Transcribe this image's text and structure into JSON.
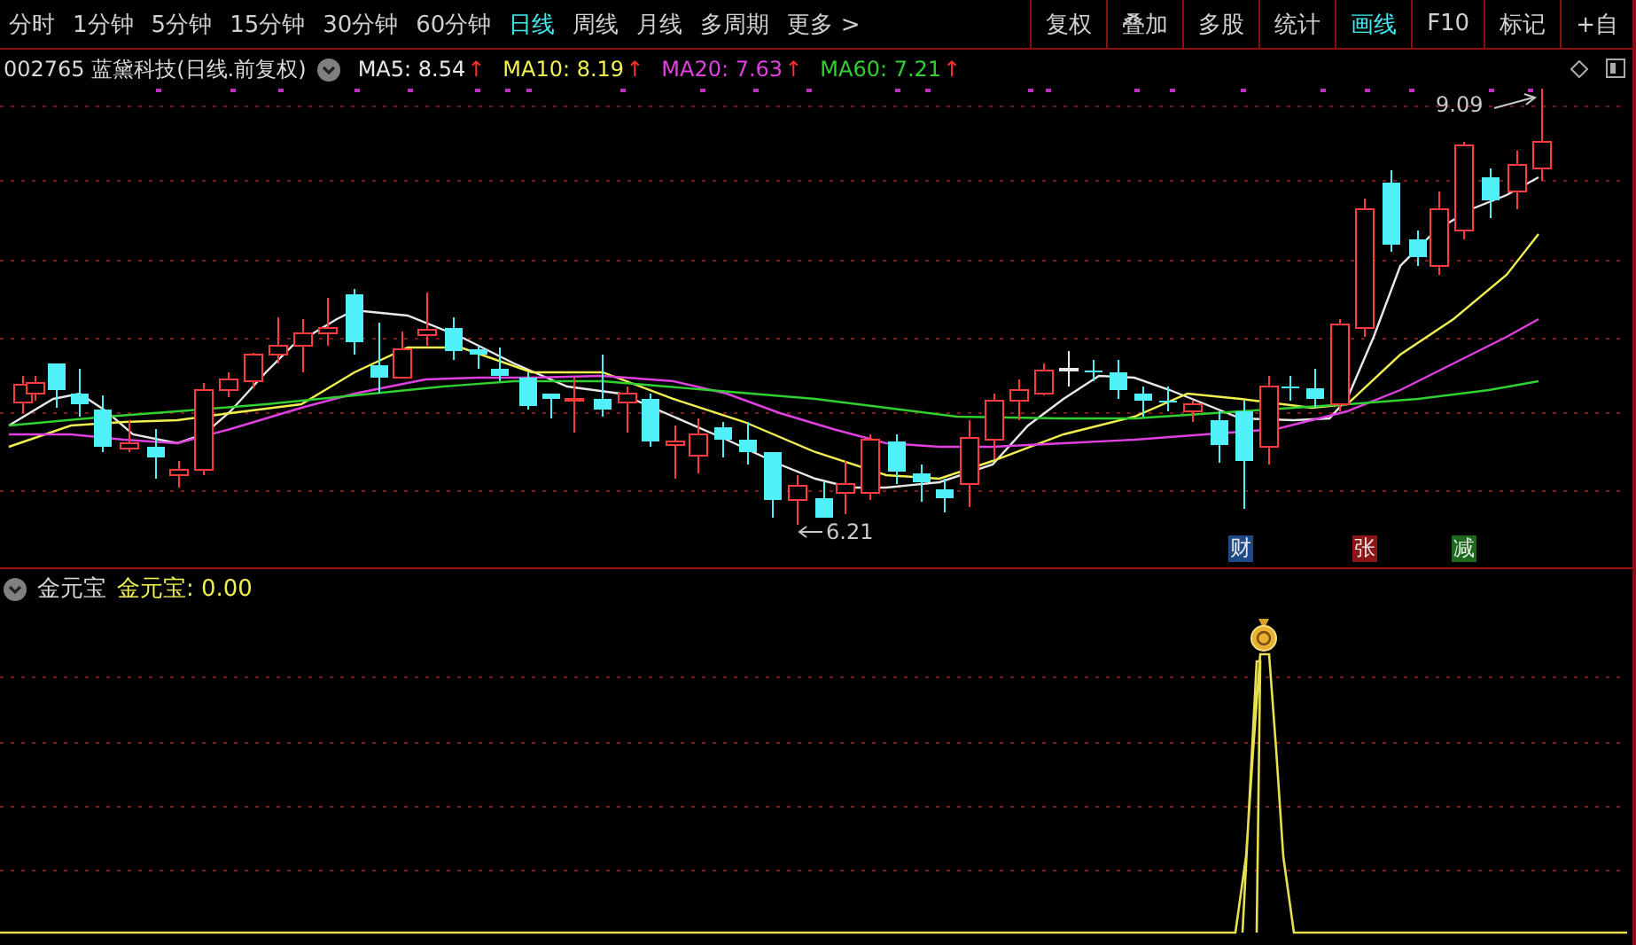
{
  "toolbar": {
    "periods": [
      {
        "label": "分时",
        "selected": false
      },
      {
        "label": "1分钟",
        "selected": false
      },
      {
        "label": "5分钟",
        "selected": false
      },
      {
        "label": "15分钟",
        "selected": false
      },
      {
        "label": "30分钟",
        "selected": false
      },
      {
        "label": "60分钟",
        "selected": false
      },
      {
        "label": "日线",
        "selected": true
      },
      {
        "label": "周线",
        "selected": false
      },
      {
        "label": "月线",
        "selected": false
      },
      {
        "label": "多周期",
        "selected": false
      }
    ],
    "more": "更多 >",
    "tools": [
      {
        "label": "复权",
        "selected": false
      },
      {
        "label": "叠加",
        "selected": false
      },
      {
        "label": "多股",
        "selected": false
      },
      {
        "label": "统计",
        "selected": false
      },
      {
        "label": "画线",
        "selected": true
      },
      {
        "label": "F10",
        "selected": false
      },
      {
        "label": "标记",
        "selected": false
      },
      {
        "label": "+自",
        "selected": false
      }
    ]
  },
  "legend": {
    "stock": "002765 蓝黛科技(日线.前复权)",
    "moving_averages": [
      {
        "label": "MA5: 8.54",
        "arrow": "↑",
        "color": "#e8e8e8"
      },
      {
        "label": "MA10: 8.19",
        "arrow": "↑",
        "color": "#f0f050"
      },
      {
        "label": "MA20: 7.63",
        "arrow": "↑",
        "color": "#e040e0"
      },
      {
        "label": "MA60: 7.21",
        "arrow": "↑",
        "color": "#30d030"
      }
    ]
  },
  "chart_labels": {
    "high": "9.09",
    "low": "6.21"
  },
  "events": [
    {
      "label": "财",
      "color": "#1d4a86"
    },
    {
      "label": "张",
      "color": "#8a1616"
    },
    {
      "label": "减",
      "color": "#1c6a1c"
    }
  ],
  "indicator": {
    "name": "金元宝",
    "reading": "金元宝: 0.00"
  }
}
